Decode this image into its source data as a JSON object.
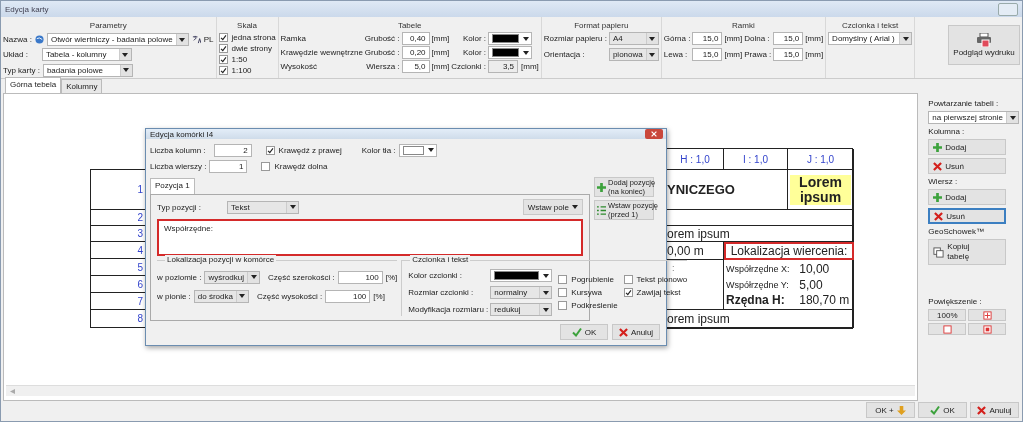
{
  "window": {
    "title": "Edycja karty"
  },
  "parameters": {
    "title": "Parametry",
    "name_label": "Nazwa :",
    "name_value": "Otwór wiertniczy - badania polowe",
    "language": "PL",
    "layout_label": "Układ :",
    "layout_value": "Tabela - kolumny",
    "type_label": "Typ karty :",
    "type_value": "badania polowe"
  },
  "scale": {
    "title": "Skala",
    "options": [
      {
        "label": "jedna strona",
        "checked": true
      },
      {
        "label": "dwie strony",
        "checked": true
      },
      {
        "label": "1:50",
        "checked": true
      },
      {
        "label": "1:100",
        "checked": true
      }
    ]
  },
  "tables": {
    "title": "Tabele",
    "rows": [
      {
        "kind": "color",
        "label": "Ramka",
        "field_label": "Grubość :",
        "value": "0,40",
        "unit": "[mm]",
        "extra_label": "Kolor :"
      },
      {
        "kind": "color",
        "label": "Krawędzie wewnętrzne",
        "field_label": "Grubość :",
        "value": "0,20",
        "unit": "[mm]",
        "extra_label": "Kolor :"
      },
      {
        "kind": "readonly",
        "label": "Wysokość",
        "field_label": "Wiersza :",
        "value": "5,0",
        "unit": "[mm]",
        "extra_label": "Czcionki :",
        "extra_value": "3,5",
        "extra_unit": "[mm]"
      }
    ]
  },
  "paper": {
    "title": "Format papieru",
    "fields": [
      {
        "label": "Rozmiar papieru :",
        "value": "A4"
      },
      {
        "label": "Orientacja :",
        "value": "pionowa"
      }
    ]
  },
  "margins": {
    "title": "Ramki",
    "fields": [
      {
        "label": "Górna :",
        "value": "15,0",
        "unit": "[mm]"
      },
      {
        "label": "Dolna :",
        "value": "15,0",
        "unit": "[mm]"
      },
      {
        "label": "Lewa :",
        "value": "15,0",
        "unit": "[mm]"
      },
      {
        "label": "Prawa :",
        "value": "15,0",
        "unit": "[mm]"
      }
    ]
  },
  "font": {
    "title": "Czcionka i tekst",
    "value": "Domyślny ( Arial )"
  },
  "print_preview": {
    "label": "Podgląd wydruku"
  },
  "tabs": [
    {
      "label": "Górna tebela",
      "selected": true
    },
    {
      "label": "Kolumny",
      "selected": false
    }
  ],
  "sheet": {
    "row_numbers": [
      "1",
      "2",
      "3",
      "4",
      "5",
      "6",
      "7",
      "8"
    ],
    "header": [
      "H : 1,0",
      "I : 1,0",
      "J : 1,0"
    ],
    "title_text": "YNICZEGO",
    "badge_text": "Lorem ipsum",
    "row3_text": "orem ipsum",
    "depth_text": "0,00 m",
    "location_text": "Lokalizacja wiercenia:",
    "location_selected": true,
    "side_text": ":",
    "coords": [
      {
        "label": "Współrzędne X:",
        "value": "10,00"
      },
      {
        "label": "Współrzędne Y:",
        "value": "5,00"
      },
      {
        "label": "Rzędna H:",
        "value": "180,70 m"
      }
    ],
    "row8_text": "orem ipsum"
  },
  "dialog": {
    "title": "Edycja komórki I4",
    "columns_label": "Liczba kolumn :",
    "columns_value": "2",
    "rows_label": "Liczba wierszy :",
    "rows_value": "1",
    "border_right": {
      "label": "Krawędź z prawej",
      "checked": true
    },
    "border_bottom": {
      "label": "Krawędź dolna",
      "checked": false
    },
    "bg_label": "Kolor tła :",
    "tabs": [
      {
        "label": "Pozycja 1",
        "selected": true
      }
    ],
    "type_label": "Typ pozycji :",
    "type_value": "Tekst",
    "insert_field": "Wstaw pole",
    "text_value": "Współrzędne:",
    "location": {
      "title": "Lokalizacja pozycji w komórce",
      "rows": [
        {
          "label": "w poziomie :",
          "value": "wyśrodkuj",
          "share_label": "Część szerokości :",
          "share_value": "100",
          "unit": "[%]"
        },
        {
          "label": "w pionie :",
          "value": "do środka",
          "share_label": "Część wysokości :",
          "share_value": "100",
          "unit": "[%]"
        }
      ]
    },
    "font": {
      "title": "Czcionka i tekst",
      "color_label": "Kolor czcionki :",
      "size_label": "Rozmiar czcionki :",
      "size_value": "normalny",
      "mod_label": "Modyfikacja rozmiaru :",
      "mod_value": "redukuj",
      "options": [
        {
          "label": "Pogrubienie",
          "checked": false
        },
        {
          "label": "Tekst pionowo",
          "checked": false
        },
        {
          "label": "Kursywa",
          "checked": false
        },
        {
          "label": "Zawijaj tekst",
          "checked": true
        },
        {
          "label": "Podkreślenie",
          "checked": false
        }
      ]
    },
    "side_buttons": [
      {
        "kind": "add",
        "lines": [
          "Dodaj pozycję",
          "(na koniec)"
        ]
      },
      {
        "kind": "insert",
        "lines": [
          "Wstaw pozycję",
          "(przed 1)"
        ]
      }
    ],
    "ok": "OK",
    "cancel": "Anuluj"
  },
  "panel": {
    "repeat_label": "Powtarzanie tabeli :",
    "repeat_value": "na pierwszej stronie",
    "groups": [
      {
        "label": "Kolumna :",
        "add": "Dodaj",
        "remove": "Usuń",
        "focused": false
      },
      {
        "label": "Wiersz :",
        "add": "Dodaj",
        "remove": "Usuń",
        "focused": true
      }
    ],
    "clipboard_label": "GeoSchowek™",
    "copy": [
      "Kopiuj",
      "tabelę"
    ],
    "zoom_label": "Powiększenie :",
    "zoom_value": "100%"
  },
  "footer": {
    "ok_plus": "OK +",
    "ok": "OK",
    "cancel": "Anuluj"
  }
}
